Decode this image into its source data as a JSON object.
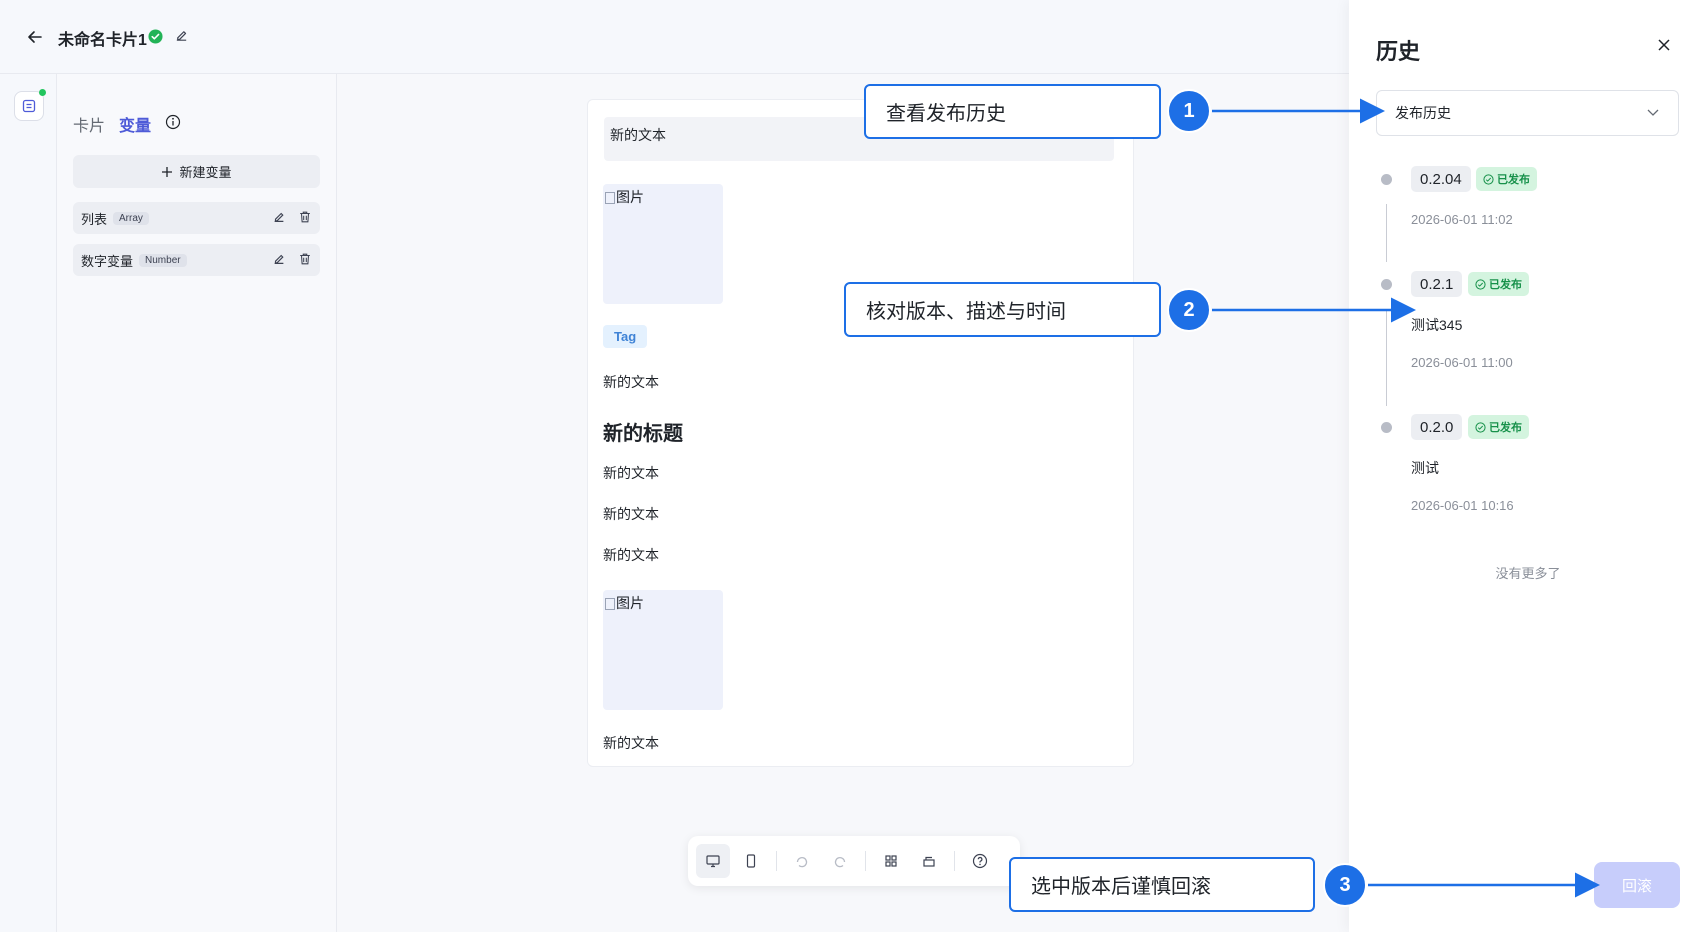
{
  "header": {
    "title": "未命名卡片1"
  },
  "var_panel": {
    "tabs": [
      "卡片",
      "变量"
    ],
    "new_var_label": "新建变量",
    "variables": [
      {
        "name": "列表",
        "type": "Array"
      },
      {
        "name": "数字变量",
        "type": "Number"
      }
    ]
  },
  "card": {
    "text_box": "新的文本",
    "image_label": "图片",
    "tag": "Tag",
    "text1": "新的文本",
    "heading": "新的标题",
    "text2": "新的文本",
    "text3": "新的文本",
    "text4": "新的文本",
    "image2_label": "图片",
    "text5": "新的文本"
  },
  "history": {
    "title": "历史",
    "filter_value": "发布历史",
    "versions": [
      {
        "version": "0.2.04",
        "status": "已发布",
        "desc": "",
        "time": "2026-06-01 11:02"
      },
      {
        "version": "0.2.1",
        "status": "已发布",
        "desc": "测试345",
        "time": "2026-06-01 11:00"
      },
      {
        "version": "0.2.0",
        "status": "已发布",
        "desc": "测试",
        "time": "2026-06-01 10:16"
      }
    ],
    "no_more": "没有更多了",
    "rollback_label": "回滚"
  },
  "annotations": [
    {
      "number": "1",
      "text": "查看发布历史"
    },
    {
      "number": "2",
      "text": "核对版本、描述与时间"
    },
    {
      "number": "3",
      "text": "选中版本后谨慎回滚"
    }
  ],
  "colors": {
    "accent": "#4e5bd8",
    "callout_blue": "#1d6fe6",
    "published_green": "#17914a",
    "published_bg": "#d4f4df",
    "rollback_disabled": "#c7cdfb"
  }
}
